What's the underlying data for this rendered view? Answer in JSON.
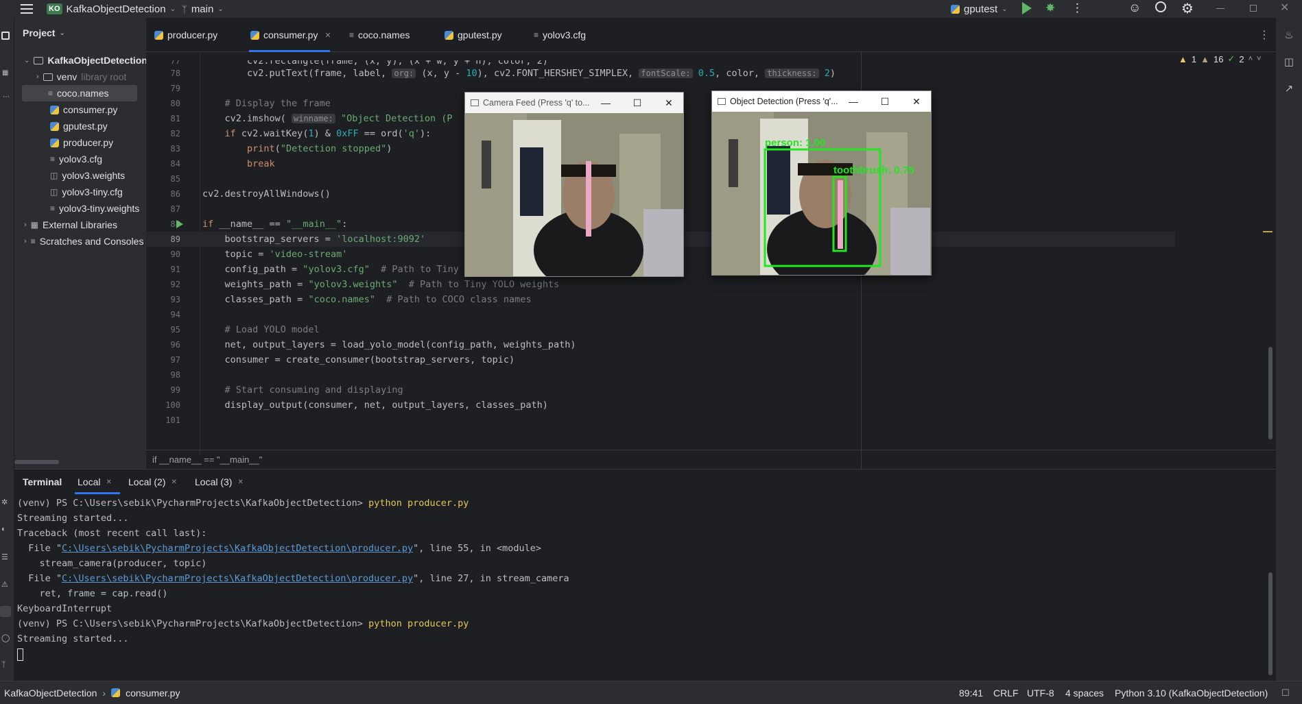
{
  "topbar": {
    "project_badge": "KO",
    "project_name": "KafkaObjectDetection",
    "branch": "main",
    "run_config": "gputest"
  },
  "project_panel": {
    "title": "Project",
    "root": "KafkaObjectDetection",
    "venv": "venv",
    "venv_hint": "library root",
    "files": [
      "coco.names",
      "consumer.py",
      "gputest.py",
      "producer.py",
      "yolov3.cfg",
      "yolov3.weights",
      "yolov3-tiny.cfg",
      "yolov3-tiny.weights"
    ],
    "external_libraries": "External Libraries",
    "scratches": "Scratches and Consoles"
  },
  "tabs": [
    "producer.py",
    "consumer.py",
    "coco.names",
    "gputest.py",
    "yolov3.cfg"
  ],
  "inspections": {
    "warn1": "1",
    "warn2": "16",
    "ok": "2"
  },
  "editor": {
    "breadcrumb": "if __name__ == \"__main__\"",
    "line_numbers": [
      "77",
      "78",
      "79",
      "80",
      "81",
      "82",
      "83",
      "84",
      "85",
      "86",
      "87",
      "88",
      "89",
      "90",
      "91",
      "92",
      "93",
      "94",
      "95",
      "96",
      "97",
      "98",
      "99",
      "100",
      "101"
    ],
    "hints": {
      "org": "org:",
      "fontScale": "fontScale:",
      "thickness": "thickness:",
      "winname": "winname:"
    }
  },
  "camera_window": {
    "title": "Camera Feed (Press 'q' to..."
  },
  "detection_window": {
    "title": "Object Detection (Press 'q'...",
    "label_person": "person: 1.00",
    "label_toothbrush": "toothbrush: 0.75"
  },
  "terminal": {
    "title": "Terminal",
    "tabs": [
      "Local",
      "Local (2)",
      "Local (3)"
    ],
    "prompt": "(venv) PS C:\\Users\\sebik\\PycharmProjects\\KafkaObjectDetection>",
    "cmd": "python producer.py",
    "streaming": "Streaming started...",
    "traceback": "Traceback (most recent call last):",
    "file_prefix": "  File \"",
    "path": "C:\\Users\\sebik\\PycharmProjects\\KafkaObjectDetection\\producer.py",
    "l1_suffix": "\", line 55, in <module>",
    "l2": "    stream_camera(producer, topic)",
    "l3_suffix": "\", line 27, in stream_camera",
    "l4": "    ret, frame = cap.read()",
    "kbi": "KeyboardInterrupt"
  },
  "statusbar": {
    "project": "KafkaObjectDetection",
    "file": "consumer.py",
    "position": "89:41",
    "line_sep": "CRLF",
    "encoding": "UTF-8",
    "indent": "4 spaces",
    "interpreter": "Python 3.10 (KafkaObjectDetection)"
  }
}
